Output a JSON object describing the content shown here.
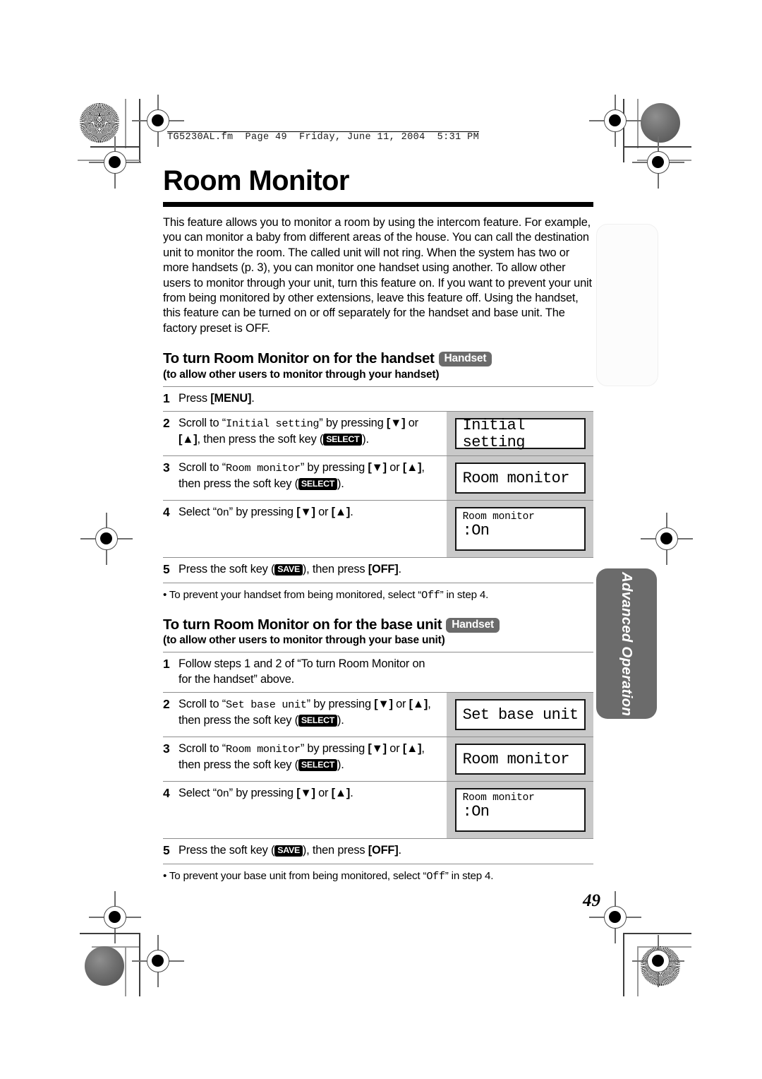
{
  "file_header": "TG5230AL.fm  Page 49  Friday, June 11, 2004  5:31 PM",
  "page_number": "49",
  "title": "Room Monitor",
  "intro": "This feature allows you to monitor a room by using the intercom feature. For example, you can monitor a baby from different areas of the house. You can call the destination unit to monitor the room. The called unit will not ring. When the system has two or more handsets (p. 3), you can monitor one handset using another. To allow other users to monitor through your unit, turn this feature on. If you want to prevent your unit from being monitored by other extensions, leave this feature off. Using the handset, this feature can be turned on or off separately for the handset and base unit. The factory preset is OFF.",
  "side_tab": {
    "label": "Advanced Operation"
  },
  "labels": {
    "badge_handset": "Handset",
    "softkey_select": "SELECT",
    "softkey_save": "SAVE",
    "down_arrow": "▼",
    "up_arrow": "▲"
  },
  "section1": {
    "heading": "To turn Room Monitor on for the handset",
    "badge": "Handset",
    "subheading": "(to allow other users to monitor through your handset)",
    "steps": [
      {
        "num": "1",
        "parts": [
          {
            "t": "plain",
            "v": "Press "
          },
          {
            "t": "bold",
            "v": "[MENU]"
          },
          {
            "t": "plain",
            "v": "."
          }
        ],
        "lcd": null
      },
      {
        "num": "2",
        "parts": [
          {
            "t": "plain",
            "v": "Scroll to “"
          },
          {
            "t": "mono",
            "v": "Initial setting"
          },
          {
            "t": "plain",
            "v": "” by pressing "
          },
          {
            "t": "bold",
            "v": "[▼]"
          },
          {
            "t": "plain",
            "v": " or "
          },
          {
            "t": "bold",
            "v": "[▲]"
          },
          {
            "t": "plain",
            "v": ", then press the soft key ("
          },
          {
            "t": "softkey",
            "v": "SELECT"
          },
          {
            "t": "plain",
            "v": ")."
          }
        ],
        "lcd": {
          "style": "one",
          "line1": "Initial setting"
        }
      },
      {
        "num": "3",
        "parts": [
          {
            "t": "plain",
            "v": "Scroll to “"
          },
          {
            "t": "mono",
            "v": "Room monitor"
          },
          {
            "t": "plain",
            "v": "” by pressing "
          },
          {
            "t": "bold",
            "v": "[▼]"
          },
          {
            "t": "plain",
            "v": " or "
          },
          {
            "t": "bold",
            "v": "[▲]"
          },
          {
            "t": "plain",
            "v": ", then press the soft key ("
          },
          {
            "t": "softkey",
            "v": "SELECT"
          },
          {
            "t": "plain",
            "v": ")."
          }
        ],
        "lcd": {
          "style": "one",
          "line1": "Room monitor"
        }
      },
      {
        "num": "4",
        "parts": [
          {
            "t": "plain",
            "v": "Select “"
          },
          {
            "t": "mono",
            "v": "On"
          },
          {
            "t": "plain",
            "v": "” by pressing "
          },
          {
            "t": "bold",
            "v": "[▼]"
          },
          {
            "t": "plain",
            "v": " or "
          },
          {
            "t": "bold",
            "v": "[▲]"
          },
          {
            "t": "plain",
            "v": "."
          }
        ],
        "lcd": {
          "style": "two",
          "line1": "Room monitor",
          "line2": ":On"
        }
      },
      {
        "num": "5",
        "parts": [
          {
            "t": "plain",
            "v": "Press the soft key ("
          },
          {
            "t": "softkey",
            "v": "SAVE"
          },
          {
            "t": "plain",
            "v": "), then press "
          },
          {
            "t": "bold",
            "v": "[OFF]"
          },
          {
            "t": "plain",
            "v": "."
          }
        ],
        "lcd": null
      }
    ],
    "note": [
      {
        "t": "plain",
        "v": "• To prevent your handset from being monitored, select “"
      },
      {
        "t": "mono",
        "v": "Off"
      },
      {
        "t": "plain",
        "v": "” in step 4."
      }
    ]
  },
  "section2": {
    "heading": "To turn Room Monitor on for the base unit",
    "badge": "Handset",
    "subheading": "(to allow other users to monitor through your base unit)",
    "steps": [
      {
        "num": "1",
        "parts": [
          {
            "t": "plain",
            "v": "Follow steps 1 and 2 of “To turn Room Monitor on for the handset” above."
          }
        ],
        "lcd": null
      },
      {
        "num": "2",
        "parts": [
          {
            "t": "plain",
            "v": "Scroll to “"
          },
          {
            "t": "mono",
            "v": "Set base unit"
          },
          {
            "t": "plain",
            "v": "” by pressing "
          },
          {
            "t": "bold",
            "v": "[▼]"
          },
          {
            "t": "plain",
            "v": " or "
          },
          {
            "t": "bold",
            "v": "[▲]"
          },
          {
            "t": "plain",
            "v": ", then press the soft key ("
          },
          {
            "t": "softkey",
            "v": "SELECT"
          },
          {
            "t": "plain",
            "v": ")."
          }
        ],
        "lcd": {
          "style": "one",
          "line1": "Set base unit"
        }
      },
      {
        "num": "3",
        "parts": [
          {
            "t": "plain",
            "v": "Scroll to “"
          },
          {
            "t": "mono",
            "v": "Room monitor"
          },
          {
            "t": "plain",
            "v": "” by pressing "
          },
          {
            "t": "bold",
            "v": "[▼]"
          },
          {
            "t": "plain",
            "v": " or "
          },
          {
            "t": "bold",
            "v": "[▲]"
          },
          {
            "t": "plain",
            "v": ", then press the soft key ("
          },
          {
            "t": "softkey",
            "v": "SELECT"
          },
          {
            "t": "plain",
            "v": ")."
          }
        ],
        "lcd": {
          "style": "one",
          "line1": "Room monitor"
        }
      },
      {
        "num": "4",
        "parts": [
          {
            "t": "plain",
            "v": "Select “"
          },
          {
            "t": "mono",
            "v": "On"
          },
          {
            "t": "plain",
            "v": "” by pressing "
          },
          {
            "t": "bold",
            "v": "[▼]"
          },
          {
            "t": "plain",
            "v": " or "
          },
          {
            "t": "bold",
            "v": "[▲]"
          },
          {
            "t": "plain",
            "v": "."
          }
        ],
        "lcd": {
          "style": "two",
          "line1": "Room monitor",
          "line2": ":On"
        }
      },
      {
        "num": "5",
        "parts": [
          {
            "t": "plain",
            "v": "Press the soft key ("
          },
          {
            "t": "softkey",
            "v": "SAVE"
          },
          {
            "t": "plain",
            "v": "), then press "
          },
          {
            "t": "bold",
            "v": "[OFF]"
          },
          {
            "t": "plain",
            "v": "."
          }
        ],
        "lcd": null
      }
    ],
    "note": [
      {
        "t": "plain",
        "v": "• To prevent your base unit from being monitored, select “"
      },
      {
        "t": "mono",
        "v": "Off"
      },
      {
        "t": "plain",
        "v": "” in step 4."
      }
    ]
  },
  "colors": {
    "lcd_column_bg": "#c9c9c9",
    "badge_gray": "#6b6b6b",
    "rule": "#8d8d8d",
    "softkey_bg": "#000000"
  }
}
